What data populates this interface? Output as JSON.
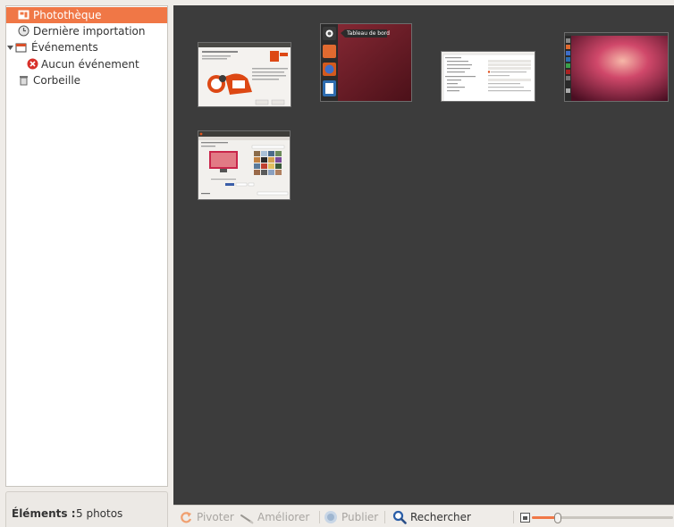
{
  "sidebar": {
    "library": "Photothèque",
    "last_import": "Dernière importation",
    "events": "Événements",
    "no_events": "Aucun événement",
    "trash": "Corbeille"
  },
  "info": {
    "label": "Éléments :",
    "value": "5 photos"
  },
  "photos": {
    "ubuntu_setup_title": "Installer Ubuntu One",
    "launcher_tooltip": "Tableau de bord"
  },
  "toolbar": {
    "rotate": "Pivoter",
    "enhance": "Améliorer",
    "publish": "Publier",
    "search": "Rechercher"
  },
  "colors": {
    "selection": "#f07746",
    "canvas": "#3c3c3c",
    "accent": "#dd4814"
  }
}
